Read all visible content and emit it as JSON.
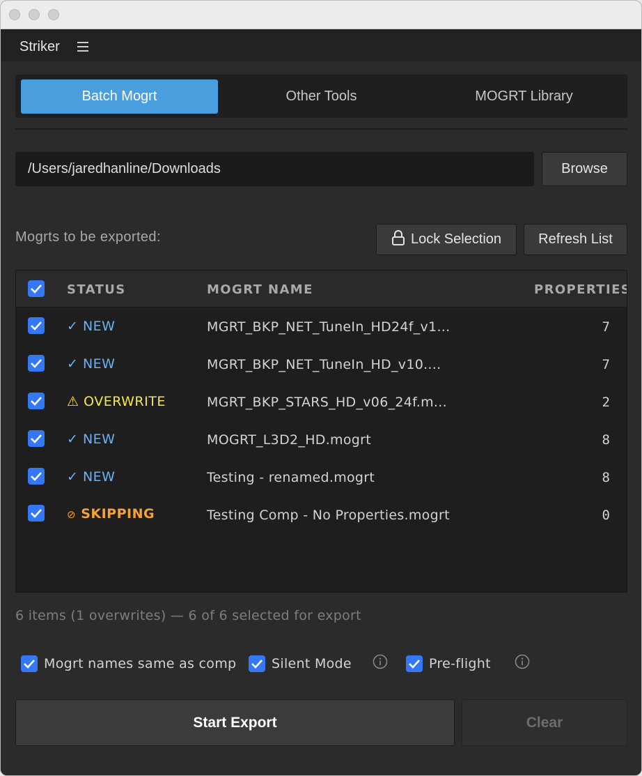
{
  "app": {
    "title": "Striker"
  },
  "tabs": [
    {
      "label": "Batch Mogrt",
      "active": true
    },
    {
      "label": "Other Tools",
      "active": false
    },
    {
      "label": "MOGRT Library",
      "active": false
    }
  ],
  "path": {
    "value": "/Users/jaredhanline/Downloads"
  },
  "browse_label": "Browse",
  "section_label": "Mogrts to be exported:",
  "lock_label": "Lock Selection",
  "refresh_label": "Refresh List",
  "table": {
    "headers": {
      "status": "STATUS",
      "name": "MOGRT NAME",
      "properties": "PROPERTIES"
    },
    "rows": [
      {
        "status": "NEW",
        "status_icon": "✓",
        "type": "new",
        "name": "MGRT_BKP_NET_TuneIn_HD24f_v1...",
        "properties": "7",
        "checked": true
      },
      {
        "status": "NEW",
        "status_icon": "✓",
        "type": "new",
        "name": "MGRT_BKP_NET_TuneIn_HD_v10....",
        "properties": "7",
        "checked": true
      },
      {
        "status": "OVERWRITE",
        "status_icon": "⚠",
        "type": "overwrite",
        "name": "MGRT_BKP_STARS_HD_v06_24f.m...",
        "properties": "2",
        "checked": true
      },
      {
        "status": "NEW",
        "status_icon": "✓",
        "type": "new",
        "name": "MOGRT_L3D2_HD.mogrt",
        "properties": "8",
        "checked": true
      },
      {
        "status": "NEW",
        "status_icon": "✓",
        "type": "new",
        "name": "Testing - renamed.mogrt",
        "properties": "8",
        "checked": true
      },
      {
        "status": "SKIPPING",
        "status_icon": "⊘",
        "type": "skipping",
        "name": "Testing Comp - No Properties.mogrt",
        "properties": "0",
        "checked": true
      }
    ]
  },
  "summary": "6 items (1 overwrites) — 6 of 6 selected for export",
  "options": {
    "names_same": "Mogrt names same as comp",
    "silent_mode": "Silent Mode",
    "preflight": "Pre-flight"
  },
  "export_label": "Start Export",
  "clear_label": "Clear",
  "colors": {
    "accent": "#4a9ede",
    "checkbox": "#3478f6",
    "status_new": "#6bb1f4",
    "status_overwrite": "#f4e84d",
    "status_skipping": "#f5a13a"
  }
}
